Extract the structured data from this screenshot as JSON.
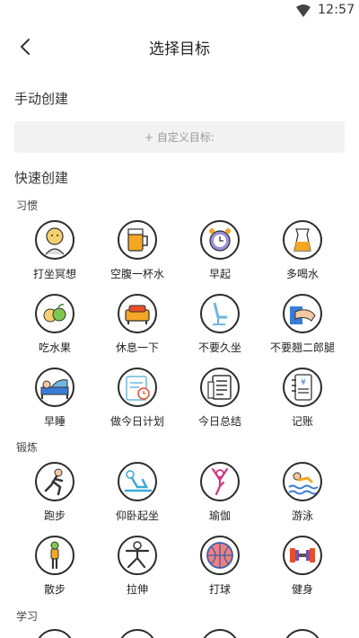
{
  "status": {
    "time": "12:57"
  },
  "header": {
    "title": "选择目标"
  },
  "manual": {
    "heading": "手动创建",
    "custom_label": "+ 自定义目标:"
  },
  "quick": {
    "heading": "快速创建"
  },
  "categories": [
    {
      "name": "习惯",
      "items": [
        {
          "label": "打坐冥想",
          "icon": "meditation-icon"
        },
        {
          "label": "空腹一杯水",
          "icon": "beer-mug-icon"
        },
        {
          "label": "早起",
          "icon": "alarm-clock-icon"
        },
        {
          "label": "多喝水",
          "icon": "water-jug-icon"
        },
        {
          "label": "吃水果",
          "icon": "fruit-icon"
        },
        {
          "label": "休息一下",
          "icon": "sofa-icon"
        },
        {
          "label": "不要久坐",
          "icon": "office-chair-icon"
        },
        {
          "label": "不要翘二郎腿",
          "icon": "crossed-legs-icon"
        },
        {
          "label": "早睡",
          "icon": "bed-icon"
        },
        {
          "label": "做今日计划",
          "icon": "calendar-plan-icon"
        },
        {
          "label": "今日总结",
          "icon": "notebook-icon"
        },
        {
          "label": "记账",
          "icon": "ledger-yen-icon"
        }
      ]
    },
    {
      "name": "锻炼",
      "items": [
        {
          "label": "跑步",
          "icon": "runner-icon"
        },
        {
          "label": "仰卧起坐",
          "icon": "situp-icon"
        },
        {
          "label": "瑜伽",
          "icon": "yoga-icon"
        },
        {
          "label": "游泳",
          "icon": "swimmer-icon"
        },
        {
          "label": "散步",
          "icon": "walker-icon"
        },
        {
          "label": "拉伸",
          "icon": "stretch-icon"
        },
        {
          "label": "打球",
          "icon": "basketball-icon"
        },
        {
          "label": "健身",
          "icon": "dumbbell-icon"
        }
      ]
    },
    {
      "name": "学习",
      "items": []
    }
  ],
  "colors": {
    "background": "#ffffff",
    "input_bg": "#f2f2f2",
    "icon_outline": "#2b2b2b"
  }
}
